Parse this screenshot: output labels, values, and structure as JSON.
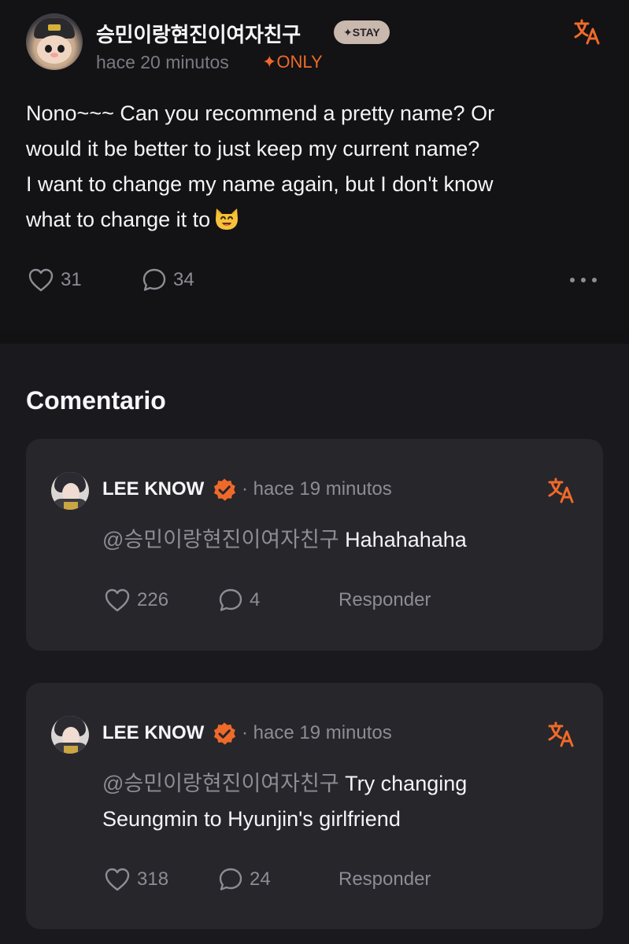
{
  "post": {
    "author": "승민이랑현진이여자친구",
    "badge": "✦STAY",
    "time": "hace 20 minutos",
    "only_tag": "✦ONLY",
    "body_lines": [
      "Nono~~~ Can you recommend a pretty name? Or",
      "would it be better to just keep my current name?",
      "I want to change my name again, but I don't know",
      "what to change it to"
    ],
    "likes": "31",
    "comments": "34"
  },
  "comments_section": {
    "title": "Comentario",
    "items": [
      {
        "author": "LEE KNOW",
        "time": "· hace 19 minutos",
        "mention": "@승민이랑현진이여자친구",
        "text": "Hahahahaha",
        "likes": "226",
        "replies": "4",
        "reply_label": "Responder"
      },
      {
        "author": "LEE KNOW",
        "time": "· hace 19 minutos",
        "mention": "@승민이랑현진이여자친구",
        "text_line1": "Try changing",
        "text_line2": "Seungmin to Hyunjin's girlfriend",
        "likes": "318",
        "replies": "24",
        "reply_label": "Responder"
      }
    ]
  },
  "colors": {
    "accent": "#ef6a2a",
    "background": "#121114",
    "card": "#27262b",
    "muted_text": "#8e8c94"
  },
  "icons": {
    "translate": "translate-icon",
    "like": "heart-icon",
    "comment": "comment-bubble-icon",
    "more": "more-dots-icon",
    "verified": "verified-badge-icon",
    "emoji": "smiling-cat-emoji"
  }
}
